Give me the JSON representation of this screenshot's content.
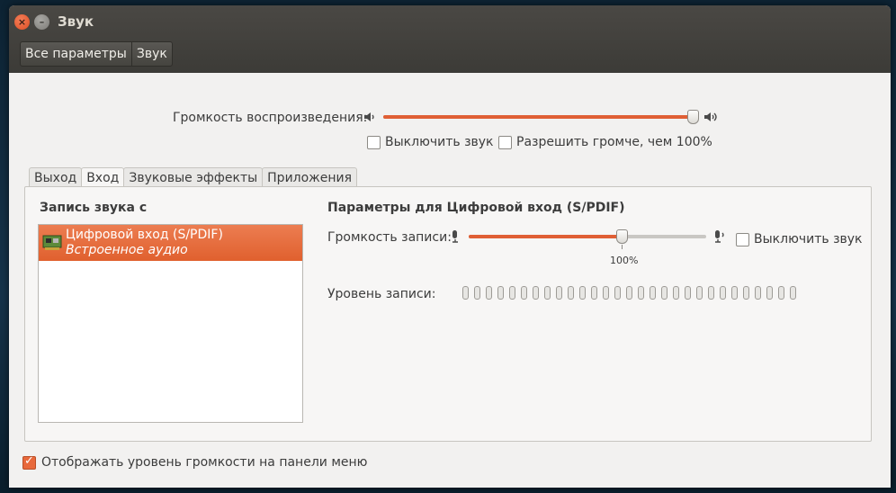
{
  "window": {
    "title": "Звук"
  },
  "breadcrumbs": [
    "Все параметры",
    "Звук"
  ],
  "output_volume": {
    "label": "Громкость воспроизведения:",
    "level_percent": 100
  },
  "checkboxes": {
    "mute": "Выключить звук",
    "allow_louder": "Разрешить громче, чем 100%"
  },
  "tabs": [
    "Выход",
    "Вход",
    "Звуковые эффекты",
    "Приложения"
  ],
  "active_tab": "Вход",
  "input": {
    "list_title": "Запись звука с",
    "devices": [
      {
        "name": "Цифровой вход (S/PDIF)",
        "description": "Встроенное аудио",
        "selected": true
      }
    ],
    "settings_title": "Параметры для Цифровой вход (S/PDIF)",
    "record_volume_label": "Громкость записи:",
    "record_volume_percent": 100,
    "record_volume_value_label": "100%",
    "mute_label": "Выключить звук",
    "level_label": "Уровень записи:",
    "level_segments": 29
  },
  "footer": {
    "show_volume_label": "Отображать уровень громкости на панели меню",
    "checked": true
  },
  "colors": {
    "accent": "#e0602e",
    "titlebar": "#3c3b37"
  }
}
